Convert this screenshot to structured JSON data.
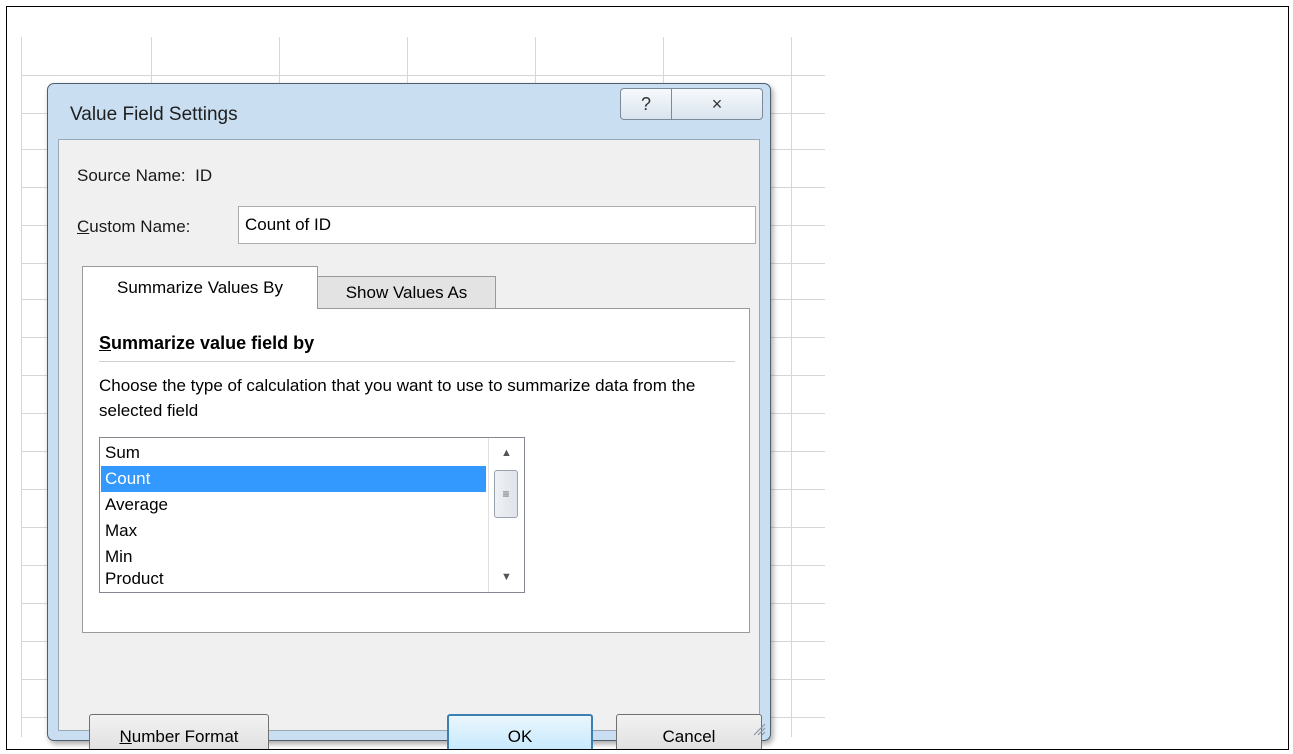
{
  "dialog": {
    "title": "Value Field Settings",
    "help_label": "?",
    "close_label": "×"
  },
  "source": {
    "label": "Source Name:",
    "value": "ID"
  },
  "custom_name": {
    "label_accel": "C",
    "label_rest": "ustom Name:",
    "value": "Count of ID"
  },
  "tabs": [
    {
      "label": "Summarize Values By",
      "active": true
    },
    {
      "label": "Show Values As",
      "active": false
    }
  ],
  "summarize": {
    "title_accel": "S",
    "title_rest": "ummarize value field by",
    "description": "Choose the type of calculation that you want to use to summarize data from the selected field",
    "items": [
      "Sum",
      "Count",
      "Average",
      "Max",
      "Min",
      "Product"
    ],
    "selected": "Count"
  },
  "buttons": {
    "number_format_accel": "N",
    "number_format_rest": "umber Format",
    "ok": "OK",
    "cancel": "Cancel"
  },
  "colors": {
    "selection": "#3399ff",
    "dialog_frame": "#c9dff1",
    "ok_border": "#3c7fb1"
  }
}
